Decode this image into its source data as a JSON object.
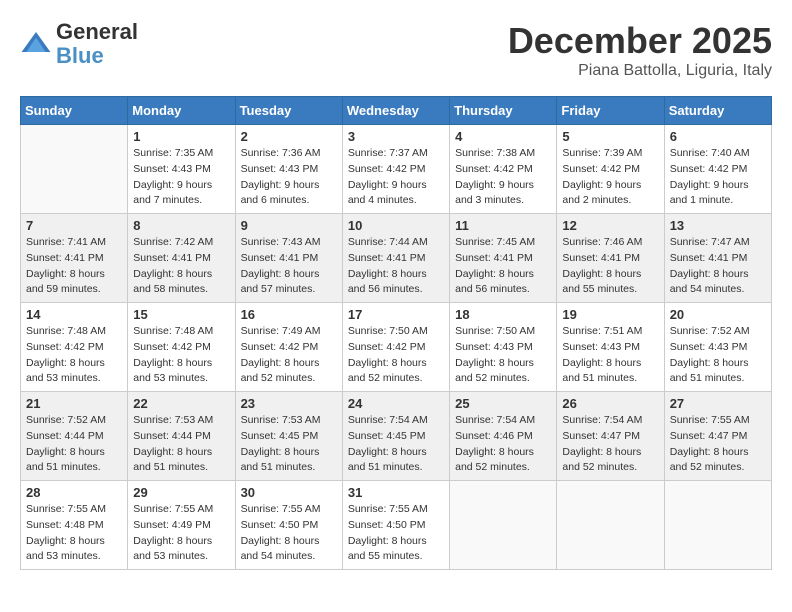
{
  "header": {
    "logo_line1": "General",
    "logo_line2": "Blue",
    "month_title": "December 2025",
    "subtitle": "Piana Battolla, Liguria, Italy"
  },
  "calendar": {
    "days_of_week": [
      "Sunday",
      "Monday",
      "Tuesday",
      "Wednesday",
      "Thursday",
      "Friday",
      "Saturday"
    ],
    "weeks": [
      [
        {
          "day": "",
          "info": ""
        },
        {
          "day": "1",
          "info": "Sunrise: 7:35 AM\nSunset: 4:43 PM\nDaylight: 9 hours\nand 7 minutes."
        },
        {
          "day": "2",
          "info": "Sunrise: 7:36 AM\nSunset: 4:43 PM\nDaylight: 9 hours\nand 6 minutes."
        },
        {
          "day": "3",
          "info": "Sunrise: 7:37 AM\nSunset: 4:42 PM\nDaylight: 9 hours\nand 4 minutes."
        },
        {
          "day": "4",
          "info": "Sunrise: 7:38 AM\nSunset: 4:42 PM\nDaylight: 9 hours\nand 3 minutes."
        },
        {
          "day": "5",
          "info": "Sunrise: 7:39 AM\nSunset: 4:42 PM\nDaylight: 9 hours\nand 2 minutes."
        },
        {
          "day": "6",
          "info": "Sunrise: 7:40 AM\nSunset: 4:42 PM\nDaylight: 9 hours\nand 1 minute."
        }
      ],
      [
        {
          "day": "7",
          "info": "Sunrise: 7:41 AM\nSunset: 4:41 PM\nDaylight: 8 hours\nand 59 minutes."
        },
        {
          "day": "8",
          "info": "Sunrise: 7:42 AM\nSunset: 4:41 PM\nDaylight: 8 hours\nand 58 minutes."
        },
        {
          "day": "9",
          "info": "Sunrise: 7:43 AM\nSunset: 4:41 PM\nDaylight: 8 hours\nand 57 minutes."
        },
        {
          "day": "10",
          "info": "Sunrise: 7:44 AM\nSunset: 4:41 PM\nDaylight: 8 hours\nand 56 minutes."
        },
        {
          "day": "11",
          "info": "Sunrise: 7:45 AM\nSunset: 4:41 PM\nDaylight: 8 hours\nand 56 minutes."
        },
        {
          "day": "12",
          "info": "Sunrise: 7:46 AM\nSunset: 4:41 PM\nDaylight: 8 hours\nand 55 minutes."
        },
        {
          "day": "13",
          "info": "Sunrise: 7:47 AM\nSunset: 4:41 PM\nDaylight: 8 hours\nand 54 minutes."
        }
      ],
      [
        {
          "day": "14",
          "info": "Sunrise: 7:48 AM\nSunset: 4:42 PM\nDaylight: 8 hours\nand 53 minutes."
        },
        {
          "day": "15",
          "info": "Sunrise: 7:48 AM\nSunset: 4:42 PM\nDaylight: 8 hours\nand 53 minutes."
        },
        {
          "day": "16",
          "info": "Sunrise: 7:49 AM\nSunset: 4:42 PM\nDaylight: 8 hours\nand 52 minutes."
        },
        {
          "day": "17",
          "info": "Sunrise: 7:50 AM\nSunset: 4:42 PM\nDaylight: 8 hours\nand 52 minutes."
        },
        {
          "day": "18",
          "info": "Sunrise: 7:50 AM\nSunset: 4:43 PM\nDaylight: 8 hours\nand 52 minutes."
        },
        {
          "day": "19",
          "info": "Sunrise: 7:51 AM\nSunset: 4:43 PM\nDaylight: 8 hours\nand 51 minutes."
        },
        {
          "day": "20",
          "info": "Sunrise: 7:52 AM\nSunset: 4:43 PM\nDaylight: 8 hours\nand 51 minutes."
        }
      ],
      [
        {
          "day": "21",
          "info": "Sunrise: 7:52 AM\nSunset: 4:44 PM\nDaylight: 8 hours\nand 51 minutes."
        },
        {
          "day": "22",
          "info": "Sunrise: 7:53 AM\nSunset: 4:44 PM\nDaylight: 8 hours\nand 51 minutes."
        },
        {
          "day": "23",
          "info": "Sunrise: 7:53 AM\nSunset: 4:45 PM\nDaylight: 8 hours\nand 51 minutes."
        },
        {
          "day": "24",
          "info": "Sunrise: 7:54 AM\nSunset: 4:45 PM\nDaylight: 8 hours\nand 51 minutes."
        },
        {
          "day": "25",
          "info": "Sunrise: 7:54 AM\nSunset: 4:46 PM\nDaylight: 8 hours\nand 52 minutes."
        },
        {
          "day": "26",
          "info": "Sunrise: 7:54 AM\nSunset: 4:47 PM\nDaylight: 8 hours\nand 52 minutes."
        },
        {
          "day": "27",
          "info": "Sunrise: 7:55 AM\nSunset: 4:47 PM\nDaylight: 8 hours\nand 52 minutes."
        }
      ],
      [
        {
          "day": "28",
          "info": "Sunrise: 7:55 AM\nSunset: 4:48 PM\nDaylight: 8 hours\nand 53 minutes."
        },
        {
          "day": "29",
          "info": "Sunrise: 7:55 AM\nSunset: 4:49 PM\nDaylight: 8 hours\nand 53 minutes."
        },
        {
          "day": "30",
          "info": "Sunrise: 7:55 AM\nSunset: 4:50 PM\nDaylight: 8 hours\nand 54 minutes."
        },
        {
          "day": "31",
          "info": "Sunrise: 7:55 AM\nSunset: 4:50 PM\nDaylight: 8 hours\nand 55 minutes."
        },
        {
          "day": "",
          "info": ""
        },
        {
          "day": "",
          "info": ""
        },
        {
          "day": "",
          "info": ""
        }
      ]
    ]
  }
}
